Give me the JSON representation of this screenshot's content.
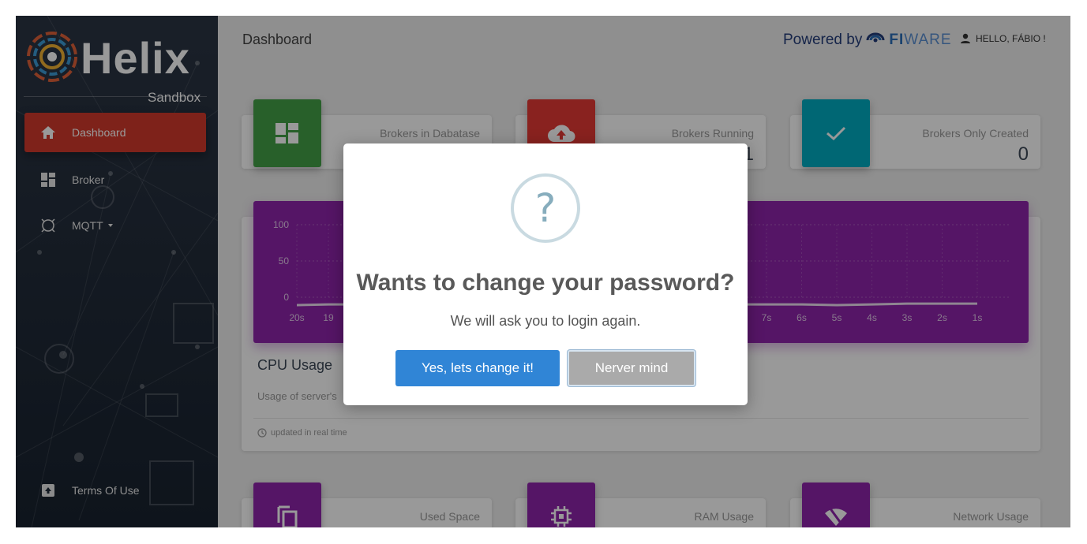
{
  "sidebar": {
    "logo_word": "Helix",
    "logo_sub": "Sandbox",
    "items": [
      {
        "label": "Dashboard",
        "icon": "home-icon",
        "active": true
      },
      {
        "label": "Broker",
        "icon": "dashboard-grid-icon",
        "active": false
      },
      {
        "label": "MQTT",
        "icon": "mqtt-icon",
        "active": false
      }
    ],
    "footer_item": {
      "label": "Terms Of Use",
      "icon": "archive-icon"
    }
  },
  "header": {
    "title": "Dashboard",
    "powered_by": "Powered by",
    "brand_fi": "FI",
    "brand_ware": "WARE",
    "user_greeting": "HELLO, FÁBIO !"
  },
  "stats_top": [
    {
      "label": "Brokers in Dabatase",
      "value": "",
      "icon": "dashboard-grid-icon",
      "color": "#43a047"
    },
    {
      "label": "Brokers Running",
      "value": "1",
      "icon": "cloud-upload-icon",
      "color": "#e53935"
    },
    {
      "label": "Brokers Only Created",
      "value": "0",
      "icon": "check-icon",
      "color": "#00acc1"
    }
  ],
  "stats_bottom": [
    {
      "label": "Used Space",
      "icon": "copy-icon",
      "color": "#8e24aa"
    },
    {
      "label": "RAM Usage",
      "icon": "chip-icon",
      "color": "#8e24aa"
    },
    {
      "label": "Network Usage",
      "icon": "wifi-off-icon",
      "color": "#8e24aa"
    }
  ],
  "cpu": {
    "title": "CPU Usage",
    "subtitle": "Usage of server's",
    "footer": "updated in real time",
    "color": "#8e24aa"
  },
  "chart_data": {
    "type": "line",
    "title": "",
    "y_ticks": [
      "100",
      "50",
      "0"
    ],
    "x_ticks": [
      "20s",
      "19",
      "7s",
      "6s",
      "5s",
      "4s",
      "3s",
      "2s",
      "1s"
    ],
    "ylim": [
      0,
      100
    ],
    "series": [
      {
        "values": [
          0,
          1,
          1,
          1,
          0,
          1,
          2,
          2,
          2
        ]
      }
    ]
  },
  "modal": {
    "icon": "?",
    "title": "Wants to change your password?",
    "text": "We will ask you to login again.",
    "confirm_label": "Yes, lets change it!",
    "cancel_label": "Nerver mind"
  }
}
